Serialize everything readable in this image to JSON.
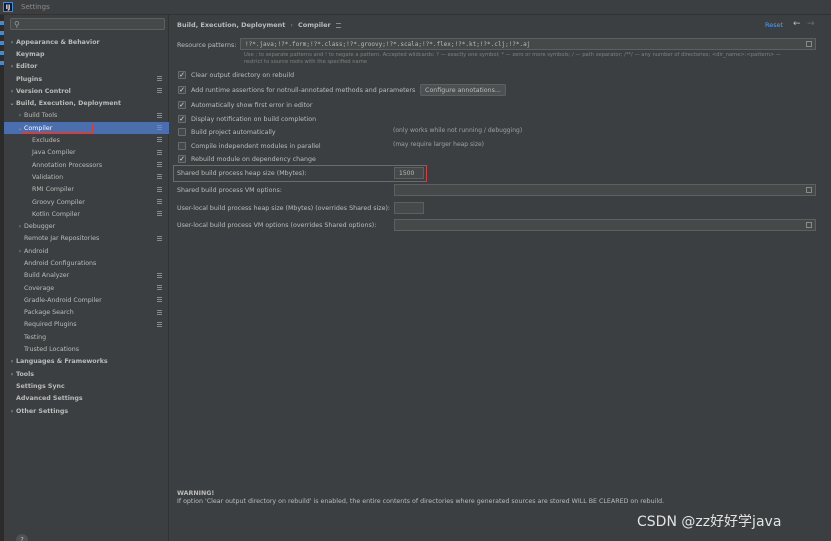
{
  "window": {
    "app_logo_text": "IJ",
    "title": "Settings"
  },
  "sidebar": {
    "search_placeholder": "",
    "tree": [
      {
        "label": "Appearance & Behavior",
        "level": 0,
        "arrow": "collapsed",
        "bold": true,
        "badge": false
      },
      {
        "label": "Keymap",
        "level": 0,
        "arrow": "none",
        "bold": true,
        "badge": false
      },
      {
        "label": "Editor",
        "level": 0,
        "arrow": "collapsed",
        "bold": true,
        "badge": false
      },
      {
        "label": "Plugins",
        "level": 0,
        "arrow": "none",
        "bold": true,
        "badge": true
      },
      {
        "label": "Version Control",
        "level": 0,
        "arrow": "collapsed",
        "bold": true,
        "badge": true
      },
      {
        "label": "Build, Execution, Deployment",
        "level": 0,
        "arrow": "expanded",
        "bold": true,
        "badge": false
      },
      {
        "label": "Build Tools",
        "level": 1,
        "arrow": "collapsed",
        "bold": false,
        "badge": true
      },
      {
        "label": "Compiler",
        "level": 1,
        "arrow": "expanded",
        "bold": false,
        "badge": true,
        "selected": true
      },
      {
        "label": "Excludes",
        "level": 2,
        "arrow": "none",
        "bold": false,
        "badge": true
      },
      {
        "label": "Java Compiler",
        "level": 2,
        "arrow": "none",
        "bold": false,
        "badge": true
      },
      {
        "label": "Annotation Processors",
        "level": 2,
        "arrow": "none",
        "bold": false,
        "badge": true
      },
      {
        "label": "Validation",
        "level": 2,
        "arrow": "none",
        "bold": false,
        "badge": true
      },
      {
        "label": "RMI Compiler",
        "level": 2,
        "arrow": "none",
        "bold": false,
        "badge": true
      },
      {
        "label": "Groovy Compiler",
        "level": 2,
        "arrow": "none",
        "bold": false,
        "badge": true
      },
      {
        "label": "Kotlin Compiler",
        "level": 2,
        "arrow": "none",
        "bold": false,
        "badge": true
      },
      {
        "label": "Debugger",
        "level": 1,
        "arrow": "collapsed",
        "bold": false,
        "badge": false
      },
      {
        "label": "Remote Jar Repositories",
        "level": 1,
        "arrow": "none",
        "bold": false,
        "badge": true
      },
      {
        "label": "Android",
        "level": 1,
        "arrow": "collapsed",
        "bold": false,
        "badge": false
      },
      {
        "label": "Android Configurations",
        "level": 1,
        "arrow": "none",
        "bold": false,
        "badge": false
      },
      {
        "label": "Build Analyzer",
        "level": 1,
        "arrow": "none",
        "bold": false,
        "badge": true
      },
      {
        "label": "Coverage",
        "level": 1,
        "arrow": "none",
        "bold": false,
        "badge": true
      },
      {
        "label": "Gradle-Android Compiler",
        "level": 1,
        "arrow": "none",
        "bold": false,
        "badge": true
      },
      {
        "label": "Package Search",
        "level": 1,
        "arrow": "none",
        "bold": false,
        "badge": true
      },
      {
        "label": "Required Plugins",
        "level": 1,
        "arrow": "none",
        "bold": false,
        "badge": true
      },
      {
        "label": "Testing",
        "level": 1,
        "arrow": "none",
        "bold": false,
        "badge": false
      },
      {
        "label": "Trusted Locations",
        "level": 1,
        "arrow": "none",
        "bold": false,
        "badge": false
      },
      {
        "label": "Languages & Frameworks",
        "level": 0,
        "arrow": "collapsed",
        "bold": true,
        "badge": false
      },
      {
        "label": "Tools",
        "level": 0,
        "arrow": "collapsed",
        "bold": true,
        "badge": false
      },
      {
        "label": "Settings Sync",
        "level": 0,
        "arrow": "none",
        "bold": true,
        "badge": false
      },
      {
        "label": "Advanced Settings",
        "level": 0,
        "arrow": "none",
        "bold": true,
        "badge": false
      },
      {
        "label": "Other Settings",
        "level": 0,
        "arrow": "collapsed",
        "bold": true,
        "badge": false
      }
    ],
    "help_label": "?"
  },
  "header": {
    "breadcrumb_parent": "Build, Execution, Deployment",
    "breadcrumb_sep": "›",
    "breadcrumb_current": "Compiler",
    "reset_label": "Reset",
    "back_glyph": "←",
    "forward_glyph": "→"
  },
  "compiler": {
    "resource_patterns_label": "Resource patterns:",
    "resource_patterns_value": "!?*.java;!?*.form;!?*.class;!?*.groovy;!?*.scala;!?*.flex;!?*.kt;!?*.clj;!?*.aj",
    "resource_patterns_hint_1": "Use ; to separate patterns and ! to negate a pattern. Accepted wildcards: ? — exactly one symbol; * — zero or more symbols; / — path separator; /**/ — any number of directories; <dir_name>:<pattern> —",
    "resource_patterns_hint_2": "restrict to source roots with the specified name",
    "checkboxes": [
      {
        "label": "Clear output directory on rebuild",
        "checked": true
      },
      {
        "label": "Add runtime assertions for notnull-annotated methods and parameters",
        "checked": true
      },
      {
        "label": "Automatically show first error in editor",
        "checked": true
      },
      {
        "label": "Display notification on build completion",
        "checked": true
      },
      {
        "label": "Build project automatically",
        "checked": false
      },
      {
        "label": "Compile independent modules in parallel",
        "checked": false
      },
      {
        "label": "Rebuild module on dependency change",
        "checked": true
      }
    ],
    "configure_annotations_label": "Configure annotations...",
    "build_auto_note": "(only works while not running / debugging)",
    "parallel_note": "(may require larger heap size)",
    "heap_size_label": "Shared build process heap size (Mbytes):",
    "heap_size_value": "1500",
    "vm_options_label": "Shared build process VM options:",
    "vm_options_value": "",
    "user_heap_label": "User-local build process heap size (Mbytes) (overrides Shared size):",
    "user_heap_value": "",
    "user_vm_label": "User-local build process VM options (overrides Shared options):",
    "user_vm_value": "",
    "warning_title": "WARNING!",
    "warning_text": "If option 'Clear output directory on rebuild' is enabled, the entire contents of directories where generated sources are stored WILL BE CLEARED on rebuild."
  },
  "watermark": "CSDN @zz好好学java",
  "colors": {
    "selection": "#4b6eaf",
    "link": "#589df6",
    "highlight_outline": "#d04040",
    "panel": "#3c3f41"
  }
}
